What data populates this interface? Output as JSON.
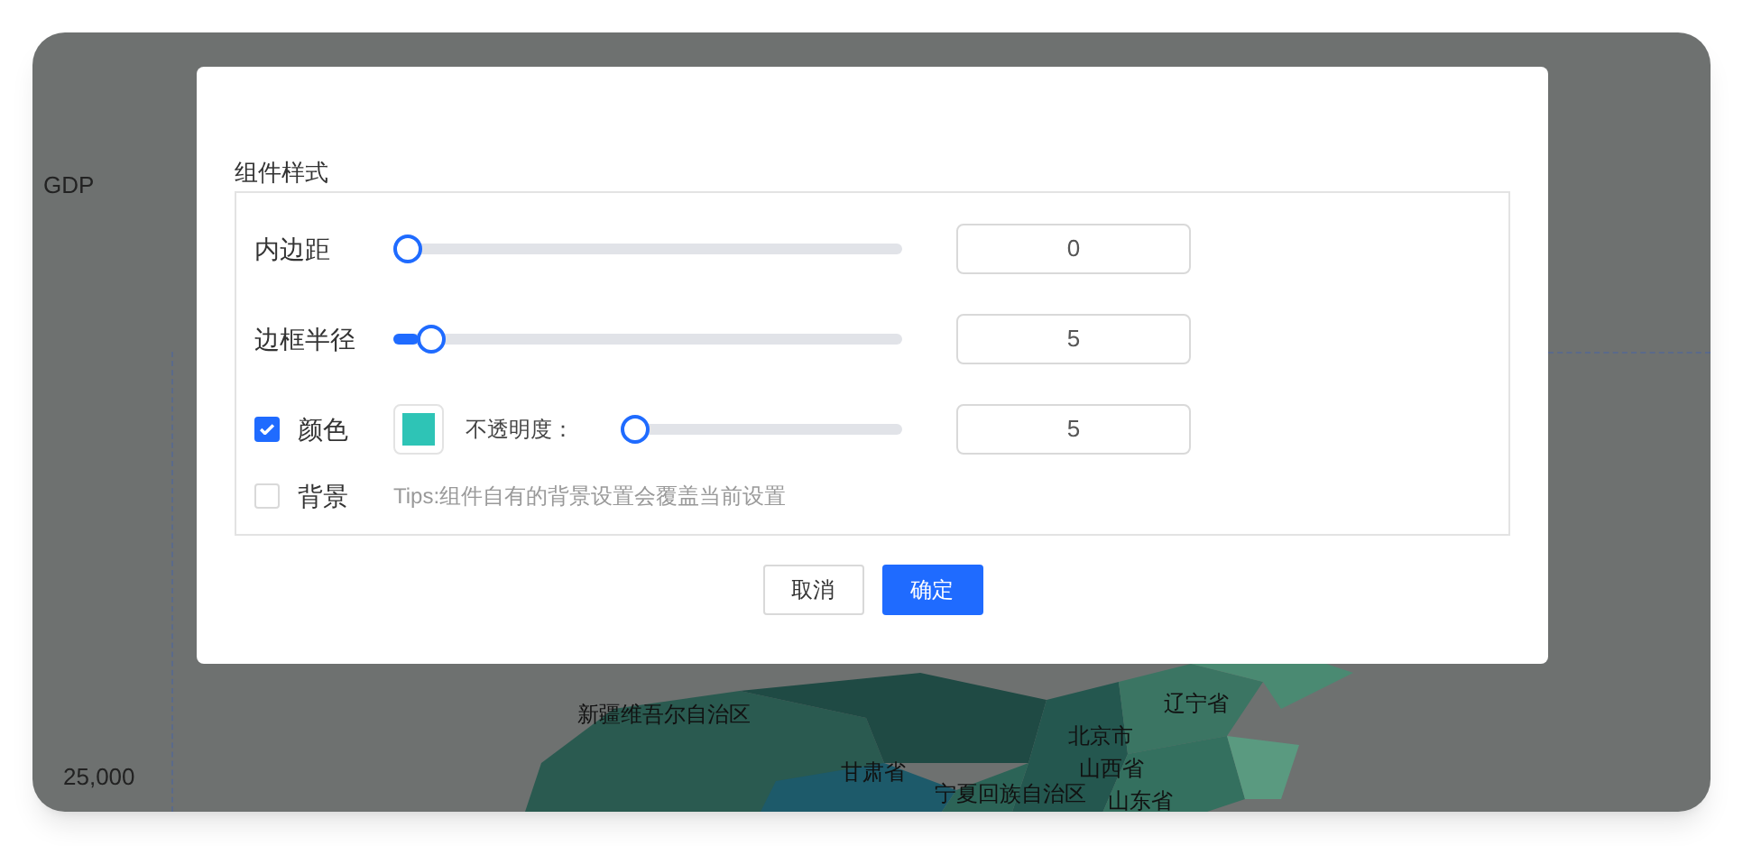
{
  "background": {
    "axis_label": "GDP",
    "tick": "25,000",
    "map_labels": [
      "新疆维吾尔自治区",
      "辽宁省",
      "北京市",
      "甘肃省",
      "宁夏回族自治区",
      "山西省",
      "山东省"
    ]
  },
  "dialog": {
    "section_title": "组件样式",
    "rows": [
      {
        "kind": "slider",
        "label": "内边距",
        "level": 0,
        "value": "0"
      },
      {
        "kind": "slider",
        "label": "边框半径",
        "level": 0.05,
        "value": "5"
      },
      {
        "kind": "color",
        "label": "颜色",
        "checked": true,
        "color": "#2ec4b6",
        "opacity_label": "不透明度：",
        "level": 0,
        "value": "5"
      },
      {
        "kind": "tip",
        "label": "背景",
        "checked": false,
        "tip": "Tips:组件自有的背景设置会覆盖当前设置"
      }
    ],
    "buttons": [
      {
        "label": "取消",
        "primary": false
      },
      {
        "label": "确定",
        "primary": true
      }
    ]
  }
}
